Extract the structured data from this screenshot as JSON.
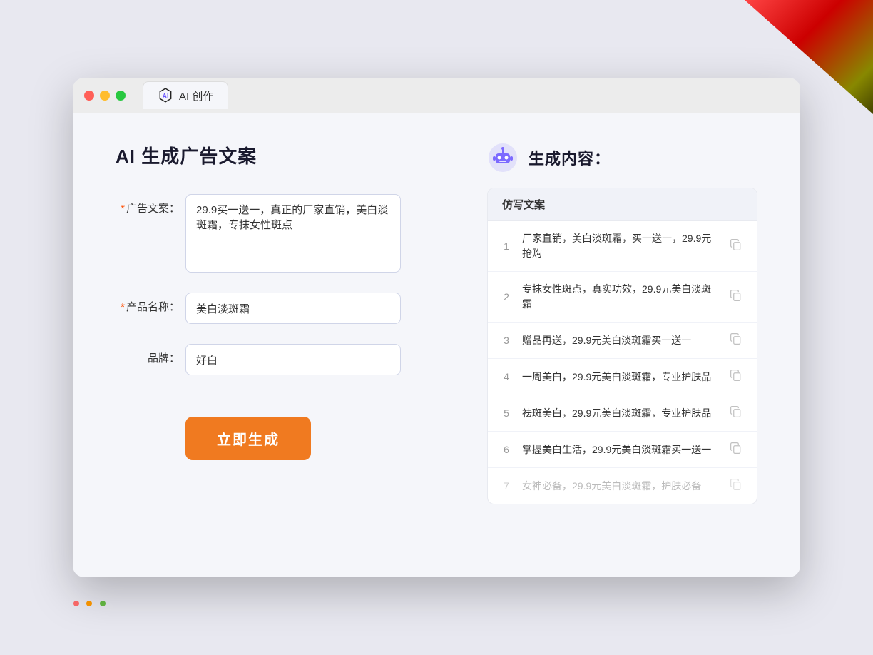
{
  "window": {
    "tab_title": "AI 创作"
  },
  "left_panel": {
    "page_title": "AI 生成广告文案",
    "form": {
      "ad_copy_label": "广告文案：",
      "ad_copy_required": "*",
      "ad_copy_value": "29.9买一送一，真正的厂家直销，美白淡斑霜，专抹女性斑点",
      "product_name_label": "产品名称：",
      "product_name_required": "*",
      "product_name_value": "美白淡斑霜",
      "brand_label": "品牌：",
      "brand_value": "好白",
      "generate_btn": "立即生成"
    }
  },
  "right_panel": {
    "title": "生成内容：",
    "table_header": "仿写文案",
    "rows": [
      {
        "num": "1",
        "text": "厂家直销，美白淡斑霜，买一送一，29.9元抢购",
        "faded": false
      },
      {
        "num": "2",
        "text": "专抹女性斑点，真实功效，29.9元美白淡斑霜",
        "faded": false
      },
      {
        "num": "3",
        "text": "赠品再送，29.9元美白淡斑霜买一送一",
        "faded": false
      },
      {
        "num": "4",
        "text": "一周美白，29.9元美白淡斑霜，专业护肤品",
        "faded": false
      },
      {
        "num": "5",
        "text": "祛斑美白，29.9元美白淡斑霜，专业护肤品",
        "faded": false
      },
      {
        "num": "6",
        "text": "掌握美白生活，29.9元美白淡斑霜买一送一",
        "faded": false
      },
      {
        "num": "7",
        "text": "女神必备，29.9元美白淡斑霜，护肤必备",
        "faded": true
      }
    ]
  }
}
